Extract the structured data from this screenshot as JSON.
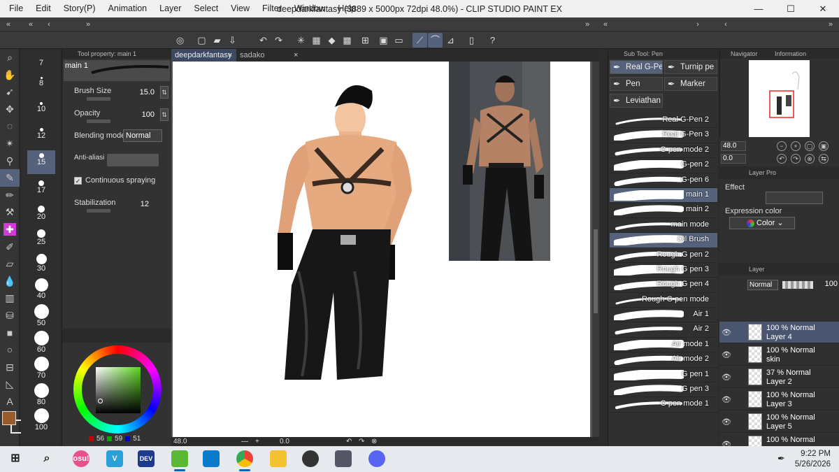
{
  "window": {
    "title": "deepdarkfantasy (3889 x 5000px 72dpi 48.0%) - CLIP STUDIO PAINT EX",
    "menu": [
      "File",
      "Edit",
      "Story(P)",
      "Animation",
      "Layer",
      "Select",
      "View",
      "Filter",
      "Window",
      "Help"
    ],
    "controls": [
      "—",
      "☐",
      "✕"
    ]
  },
  "brush_sizes": [
    "7",
    "8",
    "10",
    "12",
    "15",
    "17",
    "20",
    "25",
    "30",
    "40",
    "50",
    "60",
    "70",
    "80",
    "100"
  ],
  "tool_property": {
    "panel_title": "Tool property: main 1",
    "preset_name": "main 1",
    "brush_size_label": "Brush Size",
    "brush_size_value": "15.0",
    "opacity_label": "Opacity",
    "opacity_value": "100",
    "blending_label": "Blending mode",
    "blending_value": "Normal",
    "antialias_label": "Anti-aliasi",
    "continuous_label": "Continuous spraying",
    "stabilization_label": "Stabilization",
    "stabilization_value": "12"
  },
  "color": {
    "r": "56",
    "g": "59",
    "b": "51",
    "fg_color": "#9a5b2a"
  },
  "tabs": [
    {
      "label": "deepdarkfantasy",
      "active": true
    },
    {
      "label": "sadako",
      "active": false
    }
  ],
  "status": {
    "zoom": "48.0",
    "rotation": "0.0"
  },
  "sub_tool": {
    "panel_title": "Sub Tool: Pen",
    "categories": [
      "Real G-Pe",
      "Turnip pe",
      "Pen",
      "Marker",
      "Leviathan"
    ],
    "brushes": [
      "Real G-Pen 2",
      "Real G-Pen 3",
      "G pen mode 2",
      "G-pen 2",
      "G-pen 6",
      "main 1",
      "main 2",
      "main mode",
      "Oil Brush",
      "Rough G pen 2",
      "Rough G pen 3",
      "Rough G pen 4",
      "Rough G pen mode",
      "Air 1",
      "Air 2",
      "Air mode 1",
      "Air mode 2",
      "G pen 1",
      "G pen 3",
      "G pen mode 1"
    ],
    "selected_brushes": [
      "main 1",
      "Oil Brush"
    ]
  },
  "navigator": {
    "tab": "Navigator",
    "tab2": "Information",
    "zoom": "48.0",
    "angle": "0.0"
  },
  "layer_property": {
    "title": "Layer Pro",
    "effect_label": "Effect",
    "expression_label": "Expression color",
    "expression_value": "Color"
  },
  "layers": {
    "title": "Layer",
    "blend": "Normal",
    "opacity": "100",
    "items": [
      {
        "opacity": "100 % Normal",
        "name": "Layer 4",
        "active": true
      },
      {
        "opacity": "100 % Normal",
        "name": "skin",
        "active": false
      },
      {
        "opacity": "37 % Normal",
        "name": "Layer 2",
        "active": false
      },
      {
        "opacity": "100 % Normal",
        "name": "Layer 3",
        "active": false
      },
      {
        "opacity": "100 % Normal",
        "name": "Layer 5",
        "active": false
      },
      {
        "opacity": "100 % Normal",
        "name": "",
        "active": false
      }
    ]
  },
  "taskbar": {
    "time": "9:22 PM",
    "date": "5/26/2026",
    "apps": [
      "osu!",
      "V",
      "DEV",
      "",
      "",
      "",
      "",
      "",
      "",
      ""
    ]
  }
}
